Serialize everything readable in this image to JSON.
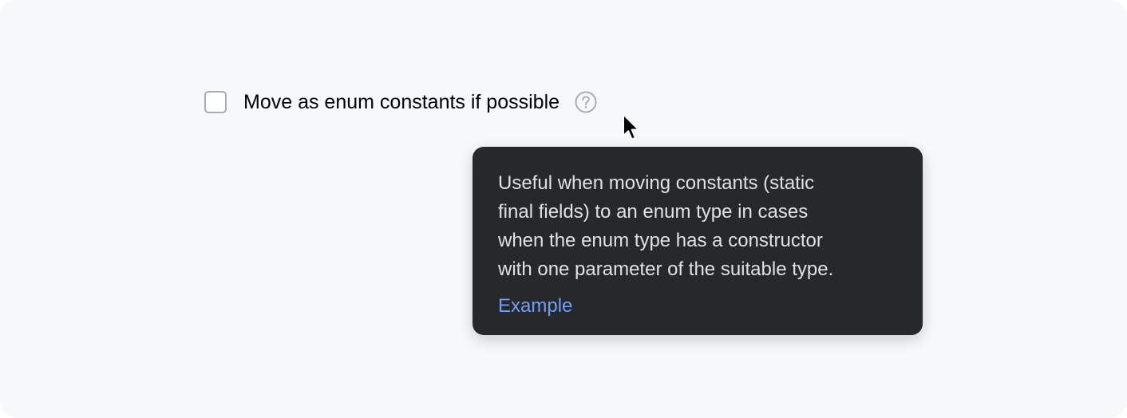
{
  "option": {
    "label": "Move as enum constants if possible",
    "checked": false
  },
  "help": {
    "icon": "question-circle-icon"
  },
  "tooltip": {
    "lines": [
      "Useful when moving constants (static",
      "final fields) to an enum type in cases",
      "when the enum type has a constructor",
      "with one parameter of the suitable type."
    ],
    "link_label": "Example"
  },
  "colors": {
    "background": "#f7f8fa",
    "tooltip_bg": "#27282c",
    "tooltip_text": "#dfe1e5",
    "link": "#6f9ef8",
    "checkbox_border": "#a9adb8"
  }
}
